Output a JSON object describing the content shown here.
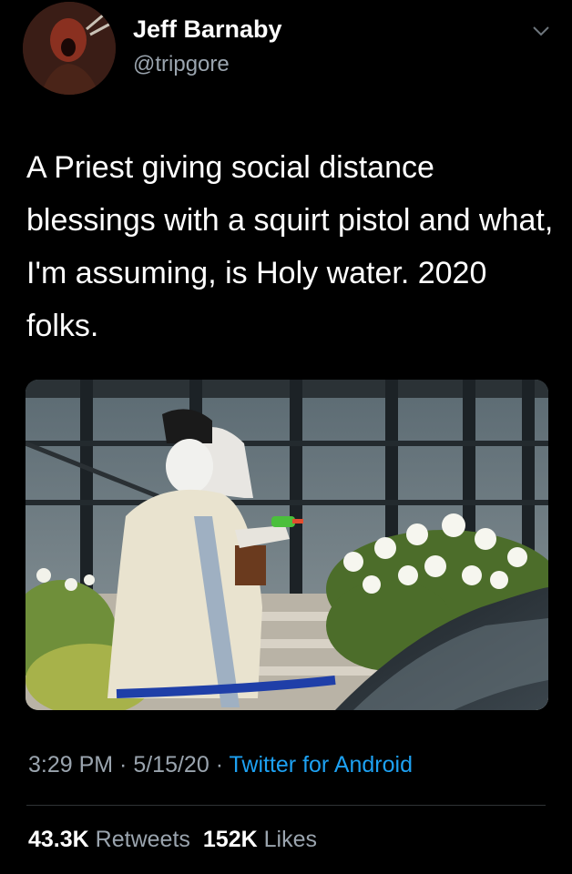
{
  "user": {
    "display_name": "Jeff Barnaby",
    "handle": "@tripgore"
  },
  "icons": {
    "more": "chevron-down-icon"
  },
  "tweet": {
    "text": "A Priest giving social distance blessings with a squirt pistol and what, I'm assuming, is Holy water. 2020 folks."
  },
  "meta": {
    "time": "3:29 PM",
    "sep1": " · ",
    "date": "5/15/20",
    "sep2": " · ",
    "client": "Twitter for Android"
  },
  "stats": {
    "retweets_count": "43.3K",
    "retweets_label": "Retweets",
    "likes_count": "152K",
    "likes_label": "Likes"
  },
  "colors": {
    "background": "#000000",
    "secondary_text": "#9aa4ae",
    "link": "#1da1f2"
  }
}
